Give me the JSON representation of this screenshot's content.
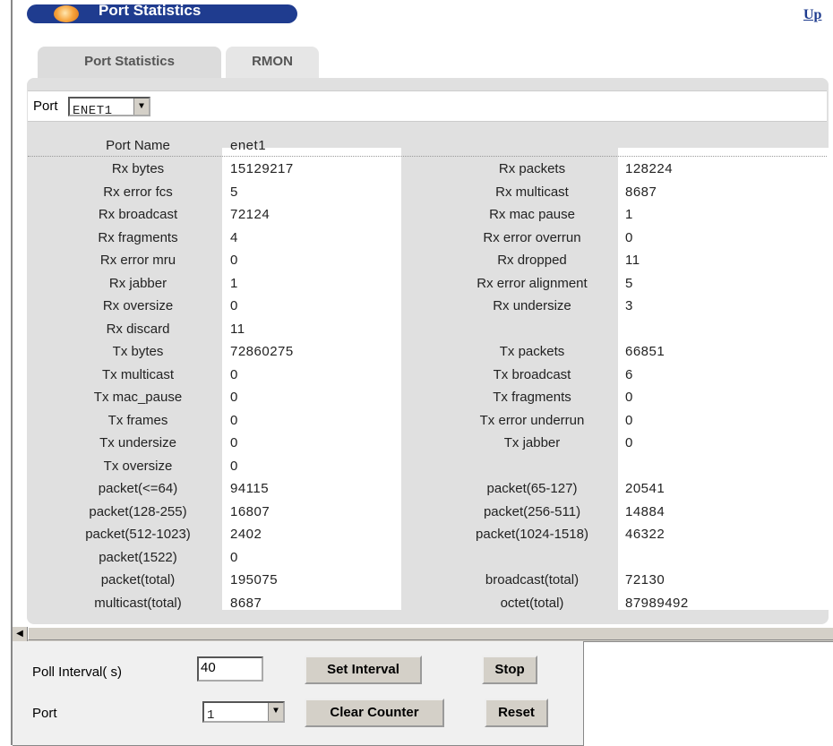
{
  "header": {
    "title": "Port Statistics",
    "up_link": "Up"
  },
  "tabs": [
    {
      "label": "Port Statistics"
    },
    {
      "label": "RMON"
    }
  ],
  "port_selector": {
    "label": "Port",
    "value": "ENET1"
  },
  "port_name": {
    "label": "Port Name",
    "value": "enet1"
  },
  "stats": [
    {
      "left_label": "Rx bytes",
      "left_value": "15129217",
      "right_label": "Rx packets",
      "right_value": "128224"
    },
    {
      "left_label": "Rx error fcs",
      "left_value": "5",
      "right_label": "Rx multicast",
      "right_value": "8687"
    },
    {
      "left_label": "Rx broadcast",
      "left_value": "72124",
      "right_label": "Rx mac pause",
      "right_value": "1"
    },
    {
      "left_label": "Rx fragments",
      "left_value": "4",
      "right_label": "Rx error overrun",
      "right_value": "0"
    },
    {
      "left_label": "Rx error mru",
      "left_value": "0",
      "right_label": "Rx dropped",
      "right_value": "11"
    },
    {
      "left_label": "Rx jabber",
      "left_value": "1",
      "right_label": "Rx error alignment",
      "right_value": "5"
    },
    {
      "left_label": "Rx oversize",
      "left_value": "0",
      "right_label": "Rx undersize",
      "right_value": "3"
    },
    {
      "left_label": "Rx discard",
      "left_value": "11",
      "right_label": "",
      "right_value": ""
    },
    {
      "left_label": "Tx bytes",
      "left_value": "72860275",
      "right_label": "Tx packets",
      "right_value": "66851"
    },
    {
      "left_label": "Tx multicast",
      "left_value": "0",
      "right_label": "Tx broadcast",
      "right_value": "6"
    },
    {
      "left_label": "Tx mac_pause",
      "left_value": "0",
      "right_label": "Tx fragments",
      "right_value": "0"
    },
    {
      "left_label": "Tx frames",
      "left_value": "0",
      "right_label": "Tx error underrun",
      "right_value": "0"
    },
    {
      "left_label": "Tx undersize",
      "left_value": "0",
      "right_label": "Tx jabber",
      "right_value": "0"
    },
    {
      "left_label": "Tx oversize",
      "left_value": "0",
      "right_label": "",
      "right_value": ""
    },
    {
      "left_label": "packet(<=64)",
      "left_value": "94115",
      "right_label": "packet(65-127)",
      "right_value": "20541"
    },
    {
      "left_label": "packet(128-255)",
      "left_value": "16807",
      "right_label": "packet(256-511)",
      "right_value": "14884"
    },
    {
      "left_label": "packet(512-1023)",
      "left_value": "2402",
      "right_label": "packet(1024-1518)",
      "right_value": "46322"
    },
    {
      "left_label": "packet(1522)",
      "left_value": "0",
      "right_label": "",
      "right_value": ""
    },
    {
      "left_label": "packet(total)",
      "left_value": "195075",
      "right_label": "broadcast(total)",
      "right_value": "72130"
    },
    {
      "left_label": "multicast(total)",
      "left_value": "8687",
      "right_label": "octet(total)",
      "right_value": "87989492"
    }
  ],
  "controls": {
    "poll_label": "Poll Interval( s)",
    "poll_value": "40",
    "set_interval_label": "Set Interval",
    "stop_label": "Stop",
    "port_label": "Port",
    "port_value": "1",
    "clear_counter_label": "Clear Counter",
    "reset_label": "Reset"
  },
  "colors": {
    "title_bar": "#1f3c8f",
    "panel": "#e0e0e0",
    "button": "#d4d0c8"
  }
}
